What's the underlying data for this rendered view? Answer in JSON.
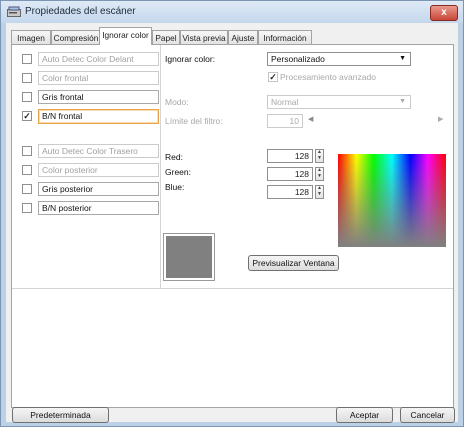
{
  "window": {
    "title": "Propiedades del escáner",
    "close_glyph": "x"
  },
  "tabs": [
    {
      "label": "Imagen"
    },
    {
      "label": "Compresión"
    },
    {
      "label": "Ignorar color"
    },
    {
      "label": "Papel"
    },
    {
      "label": "Vista previa"
    },
    {
      "label": "Ajuste"
    },
    {
      "label": "Información"
    }
  ],
  "active_tab": "Ignorar color",
  "image_list": [
    {
      "label": "Auto Detec Color Delant",
      "checked": false,
      "enabled": false
    },
    {
      "label": "Color frontal",
      "checked": false,
      "enabled": false
    },
    {
      "label": "Gris frontal",
      "checked": false,
      "enabled": true
    },
    {
      "label": "B/N frontal",
      "checked": true,
      "enabled": true,
      "selected": true
    },
    {
      "label": "Auto Detec Color Trasero",
      "checked": false,
      "enabled": false
    },
    {
      "label": "Color posterior",
      "checked": false,
      "enabled": false
    },
    {
      "label": "Gris posterior",
      "checked": false,
      "enabled": true
    },
    {
      "label": "B/N posterior",
      "checked": false,
      "enabled": true
    }
  ],
  "settings": {
    "ignore_color_label": "Ignorar color:",
    "ignore_color_value": "Personalizado",
    "advanced_processing_label": "Procesamiento avanzado",
    "advanced_processing_checked": true,
    "mode_label": "Modo:",
    "mode_value": "Normal",
    "filter_limit_label": "Límite del filtro:",
    "filter_limit_value": "10",
    "red_label": "Red:",
    "red_value": "128",
    "green_label": "Green:",
    "green_value": "128",
    "blue_label": "Blue:",
    "blue_value": "128",
    "preview_color_hex": "#808080",
    "preview_window_button": "Previsualizar Ventana"
  },
  "footer": {
    "default_button": "Predeterminada",
    "accept_button": "Aceptar",
    "cancel_button": "Cancelar"
  },
  "colors": {
    "title_bar": "#c4d7ec",
    "close_button": "#c8463a",
    "selection_border": "#e8a24c"
  },
  "icons": {
    "app": "scanner-icon",
    "close": "close-icon"
  }
}
